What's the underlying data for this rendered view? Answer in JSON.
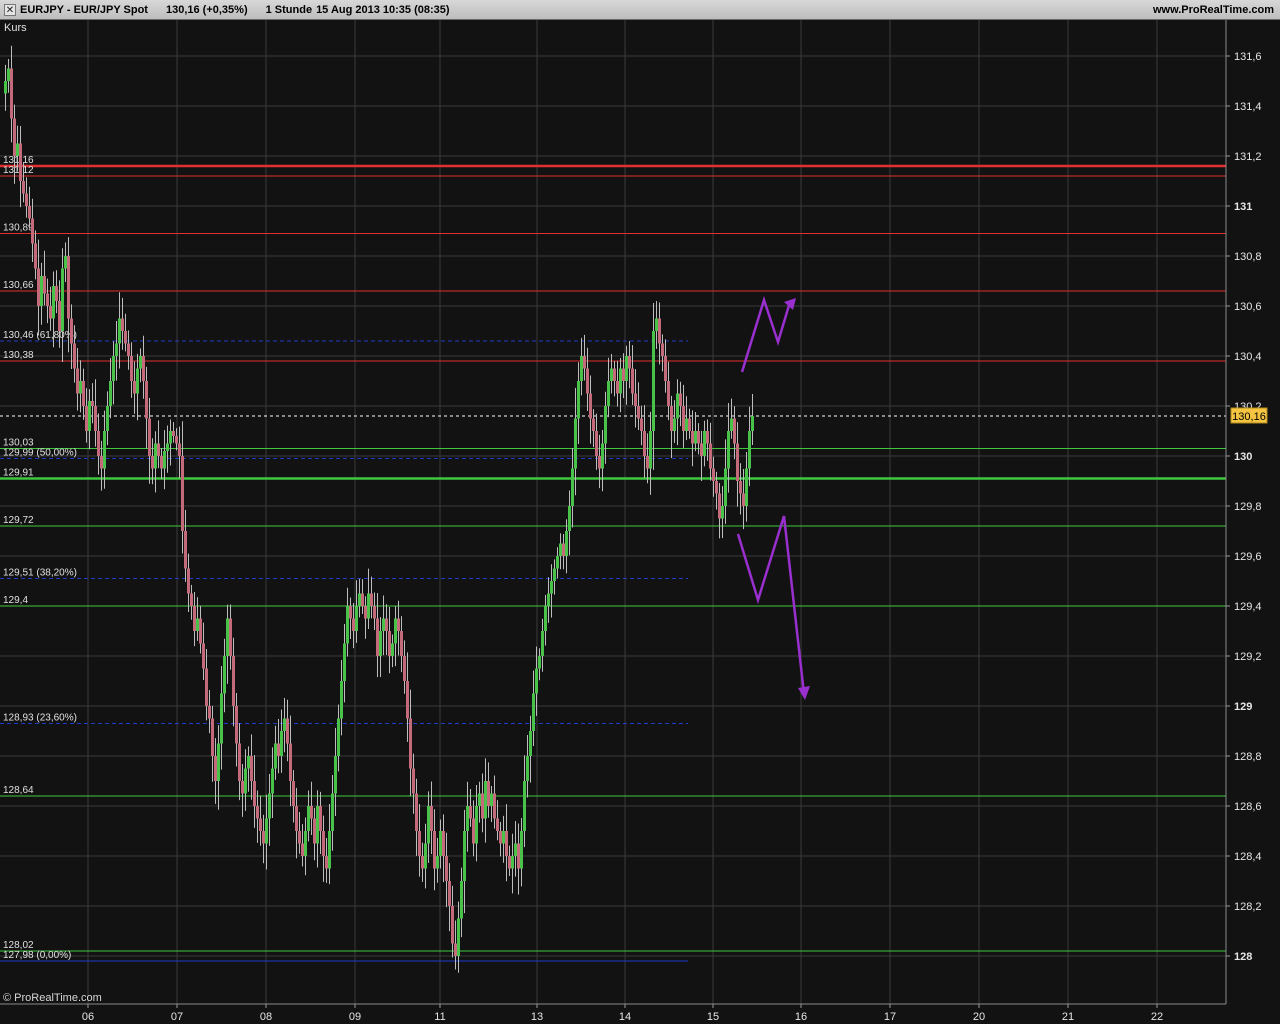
{
  "header": {
    "symbol": "EURJPY - EUR/JPY Spot",
    "quote": "130,16 (+0,35%)",
    "timeframe": "1 Stunde",
    "datetime": "15 Aug 2013 10:35 (08:35)",
    "website": "www.ProRealTime.com"
  },
  "panel_label": "Kurs",
  "copyright": "© ProRealTime.com",
  "colors": {
    "background": "#121212",
    "resistance": "#e03030",
    "support": "#3ec83e",
    "fibonacci": "#1e3cc8",
    "annotation": "#9a2fd0",
    "up_candle": "#49c24a",
    "down_candle": "#c46a7a",
    "price_tag": "#f5c542"
  },
  "chart_data": {
    "type": "candlestick",
    "instrument": "EUR/JPY",
    "interval": "1 Stunde",
    "grid": true,
    "ylim": [
      127.7,
      131.8
    ],
    "y_ticks": [
      {
        "value": 131.6,
        "label": "131,6",
        "bold": false
      },
      {
        "value": 131.4,
        "label": "131,4",
        "bold": false
      },
      {
        "value": 131.2,
        "label": "131,2",
        "bold": false
      },
      {
        "value": 131.0,
        "label": "131",
        "bold": true
      },
      {
        "value": 130.8,
        "label": "130,8",
        "bold": false
      },
      {
        "value": 130.6,
        "label": "130,6",
        "bold": false
      },
      {
        "value": 130.4,
        "label": "130,4",
        "bold": false
      },
      {
        "value": 130.2,
        "label": "130,2",
        "bold": false
      },
      {
        "value": 130.0,
        "label": "130",
        "bold": true
      },
      {
        "value": 129.8,
        "label": "129,8",
        "bold": false
      },
      {
        "value": 129.6,
        "label": "129,6",
        "bold": false
      },
      {
        "value": 129.4,
        "label": "129,4",
        "bold": false
      },
      {
        "value": 129.2,
        "label": "129,2",
        "bold": false
      },
      {
        "value": 129.0,
        "label": "129",
        "bold": true
      },
      {
        "value": 128.8,
        "label": "128,8",
        "bold": false
      },
      {
        "value": 128.6,
        "label": "128,6",
        "bold": false
      },
      {
        "value": 128.4,
        "label": "128,4",
        "bold": false
      },
      {
        "value": 128.2,
        "label": "128,2",
        "bold": false
      },
      {
        "value": 128.0,
        "label": "128",
        "bold": true
      }
    ],
    "x_ticks": [
      "06",
      "07",
      "08",
      "09",
      "11",
      "13",
      "14",
      "15",
      "16",
      "17",
      "20",
      "21",
      "22"
    ],
    "current_price": {
      "value": 130.16,
      "label": "130,16"
    },
    "levels": [
      {
        "value": 131.16,
        "label": "131,16",
        "kind": "resistance",
        "thick": true
      },
      {
        "value": 131.12,
        "label": "131,12",
        "kind": "resistance",
        "thick": false
      },
      {
        "value": 130.89,
        "label": "130,89",
        "kind": "resistance",
        "thick": false
      },
      {
        "value": 130.66,
        "label": "130,66",
        "kind": "resistance",
        "thick": false
      },
      {
        "value": 130.38,
        "label": "130,38",
        "kind": "resistance",
        "thick": false
      },
      {
        "value": 130.03,
        "label": "130,03",
        "kind": "support",
        "thick": false
      },
      {
        "value": 129.91,
        "label": "129,91",
        "kind": "support",
        "thick": true
      },
      {
        "value": 129.72,
        "label": "129,72",
        "kind": "support",
        "thick": false
      },
      {
        "value": 129.4,
        "label": "129,4",
        "kind": "support",
        "thick": false
      },
      {
        "value": 128.64,
        "label": "128,64",
        "kind": "support",
        "thick": false
      },
      {
        "value": 128.02,
        "label": "128,02",
        "kind": "support",
        "thick": false
      }
    ],
    "fibonacci": [
      {
        "value": 130.46,
        "label": "130,46 (61,80%)"
      },
      {
        "value": 129.99,
        "label": "129,99 (50,00%)"
      },
      {
        "value": 129.51,
        "label": "129,51 (38,20%)"
      },
      {
        "value": 128.93,
        "label": "128,93 (23,60%)"
      },
      {
        "value": 127.98,
        "label": "127,98 (0,00%)"
      }
    ],
    "price_path": [
      [
        0,
        131.45
      ],
      [
        3,
        131.5
      ],
      [
        6,
        131.55
      ],
      [
        9,
        131.35
      ],
      [
        12,
        131.2
      ],
      [
        15,
        131.25
      ],
      [
        18,
        131.1
      ],
      [
        21,
        131.05
      ],
      [
        24,
        131.0
      ],
      [
        27,
        130.95
      ],
      [
        30,
        130.85
      ],
      [
        33,
        130.75
      ],
      [
        36,
        130.6
      ],
      [
        39,
        130.72
      ],
      [
        42,
        130.65
      ],
      [
        45,
        130.6
      ],
      [
        48,
        130.55
      ],
      [
        51,
        130.68
      ],
      [
        54,
        130.62
      ],
      [
        57,
        130.5
      ],
      [
        60,
        130.75
      ],
      [
        63,
        130.8
      ],
      [
        66,
        130.55
      ],
      [
        69,
        130.45
      ],
      [
        72,
        130.35
      ],
      [
        75,
        130.25
      ],
      [
        78,
        130.3
      ],
      [
        81,
        130.2
      ],
      [
        84,
        130.1
      ],
      [
        87,
        130.22
      ],
      [
        90,
        130.2
      ],
      [
        93,
        130.1
      ],
      [
        96,
        130.0
      ],
      [
        99,
        129.95
      ],
      [
        102,
        130.1
      ],
      [
        105,
        130.2
      ],
      [
        108,
        130.3
      ],
      [
        111,
        130.4
      ],
      [
        114,
        130.45
      ],
      [
        117,
        130.55
      ],
      [
        120,
        130.5
      ],
      [
        123,
        130.45
      ],
      [
        126,
        130.4
      ],
      [
        129,
        130.3
      ],
      [
        132,
        130.25
      ],
      [
        135,
        130.35
      ],
      [
        138,
        130.4
      ],
      [
        141,
        130.3
      ],
      [
        144,
        130.15
      ],
      [
        147,
        130.0
      ],
      [
        150,
        129.95
      ],
      [
        153,
        130.05
      ],
      [
        156,
        130.0
      ],
      [
        159,
        129.95
      ],
      [
        162,
        130.02
      ],
      [
        165,
        130.05
      ],
      [
        168,
        130.1
      ],
      [
        171,
        130.08
      ],
      [
        174,
        130.05
      ],
      [
        177,
        130.0
      ],
      [
        180,
        129.7
      ],
      [
        183,
        129.55
      ],
      [
        186,
        129.45
      ],
      [
        189,
        129.4
      ],
      [
        192,
        129.3
      ],
      [
        195,
        129.35
      ],
      [
        198,
        129.25
      ],
      [
        201,
        129.15
      ],
      [
        204,
        129.0
      ],
      [
        207,
        128.95
      ],
      [
        210,
        128.8
      ],
      [
        213,
        128.7
      ],
      [
        216,
        128.85
      ],
      [
        219,
        129.05
      ],
      [
        222,
        129.2
      ],
      [
        225,
        129.35
      ],
      [
        228,
        129.2
      ],
      [
        231,
        129.0
      ],
      [
        234,
        128.85
      ],
      [
        237,
        128.7
      ],
      [
        240,
        128.65
      ],
      [
        243,
        128.75
      ],
      [
        246,
        128.8
      ],
      [
        249,
        128.7
      ],
      [
        252,
        128.6
      ],
      [
        255,
        128.55
      ],
      [
        258,
        128.5
      ],
      [
        261,
        128.45
      ],
      [
        264,
        128.55
      ],
      [
        267,
        128.65
      ],
      [
        270,
        128.75
      ],
      [
        273,
        128.85
      ],
      [
        276,
        128.8
      ],
      [
        279,
        128.9
      ],
      [
        282,
        128.95
      ],
      [
        285,
        128.85
      ],
      [
        288,
        128.7
      ],
      [
        291,
        128.6
      ],
      [
        294,
        128.5
      ],
      [
        297,
        128.45
      ],
      [
        300,
        128.4
      ],
      [
        303,
        128.5
      ],
      [
        306,
        128.6
      ],
      [
        309,
        128.55
      ],
      [
        312,
        128.45
      ],
      [
        315,
        128.6
      ],
      [
        318,
        128.5
      ],
      [
        321,
        128.4
      ],
      [
        324,
        128.35
      ],
      [
        327,
        128.5
      ],
      [
        330,
        128.65
      ],
      [
        333,
        128.8
      ],
      [
        336,
        128.95
      ],
      [
        339,
        129.1
      ],
      [
        342,
        129.25
      ],
      [
        345,
        129.4
      ],
      [
        348,
        129.35
      ],
      [
        351,
        129.3
      ],
      [
        354,
        129.4
      ],
      [
        357,
        129.45
      ],
      [
        360,
        129.4
      ],
      [
        363,
        129.35
      ],
      [
        366,
        129.45
      ],
      [
        369,
        129.4
      ],
      [
        372,
        129.35
      ],
      [
        375,
        129.2
      ],
      [
        378,
        129.3
      ],
      [
        381,
        129.35
      ],
      [
        384,
        129.3
      ],
      [
        387,
        129.2
      ],
      [
        390,
        129.25
      ],
      [
        393,
        129.35
      ],
      [
        396,
        129.3
      ],
      [
        399,
        129.2
      ],
      [
        402,
        129.1
      ],
      [
        405,
        128.95
      ],
      [
        408,
        128.75
      ],
      [
        411,
        128.65
      ],
      [
        414,
        128.5
      ],
      [
        417,
        128.4
      ],
      [
        420,
        128.35
      ],
      [
        423,
        128.45
      ],
      [
        426,
        128.6
      ],
      [
        429,
        128.5
      ],
      [
        432,
        128.35
      ],
      [
        435,
        128.4
      ],
      [
        438,
        128.5
      ],
      [
        441,
        128.4
      ],
      [
        444,
        128.3
      ],
      [
        447,
        128.2
      ],
      [
        450,
        128.05
      ],
      [
        453,
        128.0
      ],
      [
        456,
        128.15
      ],
      [
        459,
        128.3
      ],
      [
        462,
        128.5
      ],
      [
        465,
        128.6
      ],
      [
        468,
        128.55
      ],
      [
        471,
        128.45
      ],
      [
        474,
        128.6
      ],
      [
        477,
        128.65
      ],
      [
        480,
        128.55
      ],
      [
        483,
        128.7
      ],
      [
        486,
        128.6
      ],
      [
        489,
        128.65
      ],
      [
        492,
        128.55
      ],
      [
        495,
        128.5
      ],
      [
        498,
        128.45
      ],
      [
        501,
        128.5
      ],
      [
        504,
        128.4
      ],
      [
        507,
        128.35
      ],
      [
        510,
        128.4
      ],
      [
        513,
        128.45
      ],
      [
        516,
        128.35
      ],
      [
        519,
        128.5
      ],
      [
        522,
        128.7
      ],
      [
        525,
        128.8
      ],
      [
        528,
        128.9
      ],
      [
        531,
        129.05
      ],
      [
        534,
        129.15
      ],
      [
        537,
        129.2
      ],
      [
        540,
        129.3
      ],
      [
        543,
        129.4
      ],
      [
        546,
        129.45
      ],
      [
        549,
        129.5
      ],
      [
        552,
        129.55
      ],
      [
        555,
        129.6
      ],
      [
        558,
        129.65
      ],
      [
        561,
        129.6
      ],
      [
        564,
        129.7
      ],
      [
        567,
        129.8
      ],
      [
        570,
        129.95
      ],
      [
        573,
        130.15
      ],
      [
        576,
        130.3
      ],
      [
        579,
        130.4
      ],
      [
        582,
        130.35
      ],
      [
        585,
        130.25
      ],
      [
        588,
        130.15
      ],
      [
        591,
        130.1
      ],
      [
        594,
        130.0
      ],
      [
        597,
        129.95
      ],
      [
        600,
        130.05
      ],
      [
        603,
        130.2
      ],
      [
        606,
        130.3
      ],
      [
        609,
        130.35
      ],
      [
        612,
        130.3
      ],
      [
        615,
        130.25
      ],
      [
        618,
        130.35
      ],
      [
        621,
        130.3
      ],
      [
        624,
        130.4
      ],
      [
        627,
        130.35
      ],
      [
        630,
        130.25
      ],
      [
        633,
        130.2
      ],
      [
        636,
        130.15
      ],
      [
        639,
        130.1
      ],
      [
        642,
        130.0
      ],
      [
        645,
        129.95
      ],
      [
        648,
        130.1
      ],
      [
        651,
        130.5
      ],
      [
        654,
        130.55
      ],
      [
        657,
        130.45
      ],
      [
        660,
        130.4
      ],
      [
        663,
        130.3
      ],
      [
        666,
        130.2
      ],
      [
        669,
        130.1
      ],
      [
        672,
        130.15
      ],
      [
        675,
        130.25
      ],
      [
        678,
        130.2
      ],
      [
        681,
        130.1
      ],
      [
        684,
        130.15
      ],
      [
        687,
        130.1
      ],
      [
        690,
        130.05
      ],
      [
        693,
        130.1
      ],
      [
        696,
        130.05
      ],
      [
        699,
        130.0
      ],
      [
        702,
        130.1
      ],
      [
        705,
        130.05
      ],
      [
        708,
        129.95
      ],
      [
        711,
        129.9
      ],
      [
        714,
        129.85
      ],
      [
        717,
        129.75
      ],
      [
        720,
        129.8
      ],
      [
        723,
        129.95
      ],
      [
        726,
        130.1
      ],
      [
        729,
        130.15
      ],
      [
        732,
        130.05
      ],
      [
        735,
        129.9
      ],
      [
        738,
        129.85
      ],
      [
        741,
        129.8
      ],
      [
        744,
        129.95
      ],
      [
        747,
        130.1
      ],
      [
        750,
        130.16
      ]
    ]
  }
}
